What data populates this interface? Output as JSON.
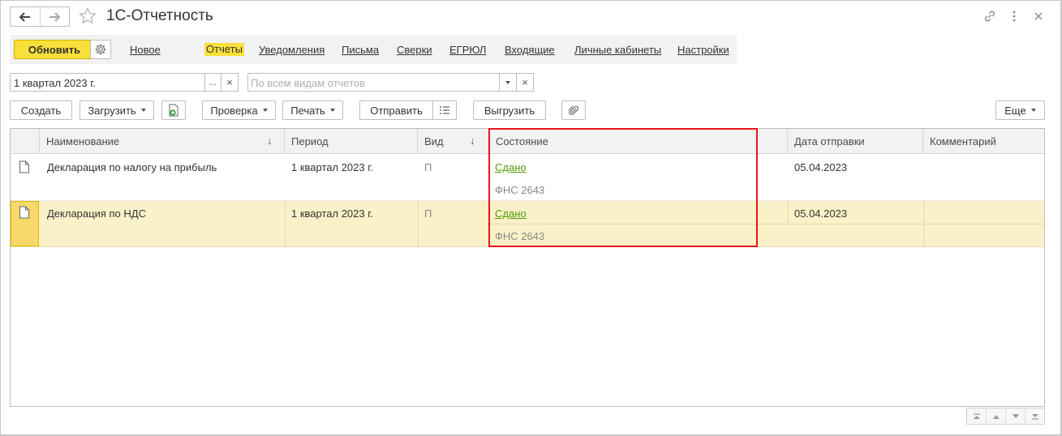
{
  "window": {
    "title": "1С-Отчетность"
  },
  "commandbar": {
    "update_label": "Обновить",
    "links": [
      {
        "label": "Новое"
      },
      {
        "label": "Отчеты"
      },
      {
        "label": "Уведомления"
      },
      {
        "label": "Письма"
      },
      {
        "label": "Сверки"
      },
      {
        "label": "ЕГРЮЛ"
      },
      {
        "label": "Входящие"
      },
      {
        "label": "Личные кабинеты"
      },
      {
        "label": "Настройки"
      }
    ],
    "active_link": "Отчеты"
  },
  "filters": {
    "period_value": "1 квартал 2023 г.",
    "period_select_label": "...",
    "clear_label": "×",
    "type_placeholder": "По всем видам отчетов"
  },
  "toolbar": {
    "create_label": "Создать",
    "load_label": "Загрузить",
    "check_label": "Проверка",
    "print_label": "Печать",
    "send_label": "Отправить",
    "export_label": "Выгрузить",
    "more_label": "Еще"
  },
  "table": {
    "columns": {
      "name": "Наименование",
      "period": "Период",
      "kind": "Вид",
      "status": "Состояние",
      "sent_date": "Дата отправки",
      "comment": "Комментарий"
    },
    "rows": [
      {
        "name": "Декларация по налогу на прибыль",
        "period": "1 квартал 2023 г.",
        "kind": "П",
        "status": "Сдано",
        "recipient": "ФНС 2643",
        "sent_date": "05.04.2023",
        "comment": ""
      },
      {
        "name": "Декларация по НДС",
        "period": "1 квартал 2023 г.",
        "kind": "П",
        "status": "Сдано",
        "recipient": "ФНС 2643",
        "sent_date": "05.04.2023",
        "comment": ""
      }
    ]
  },
  "colors": {
    "accent_yellow": "#f9df3a",
    "selected_row": "#fbf1c8",
    "status_green": "#4e9a06",
    "highlight_red": "#e8141c"
  }
}
